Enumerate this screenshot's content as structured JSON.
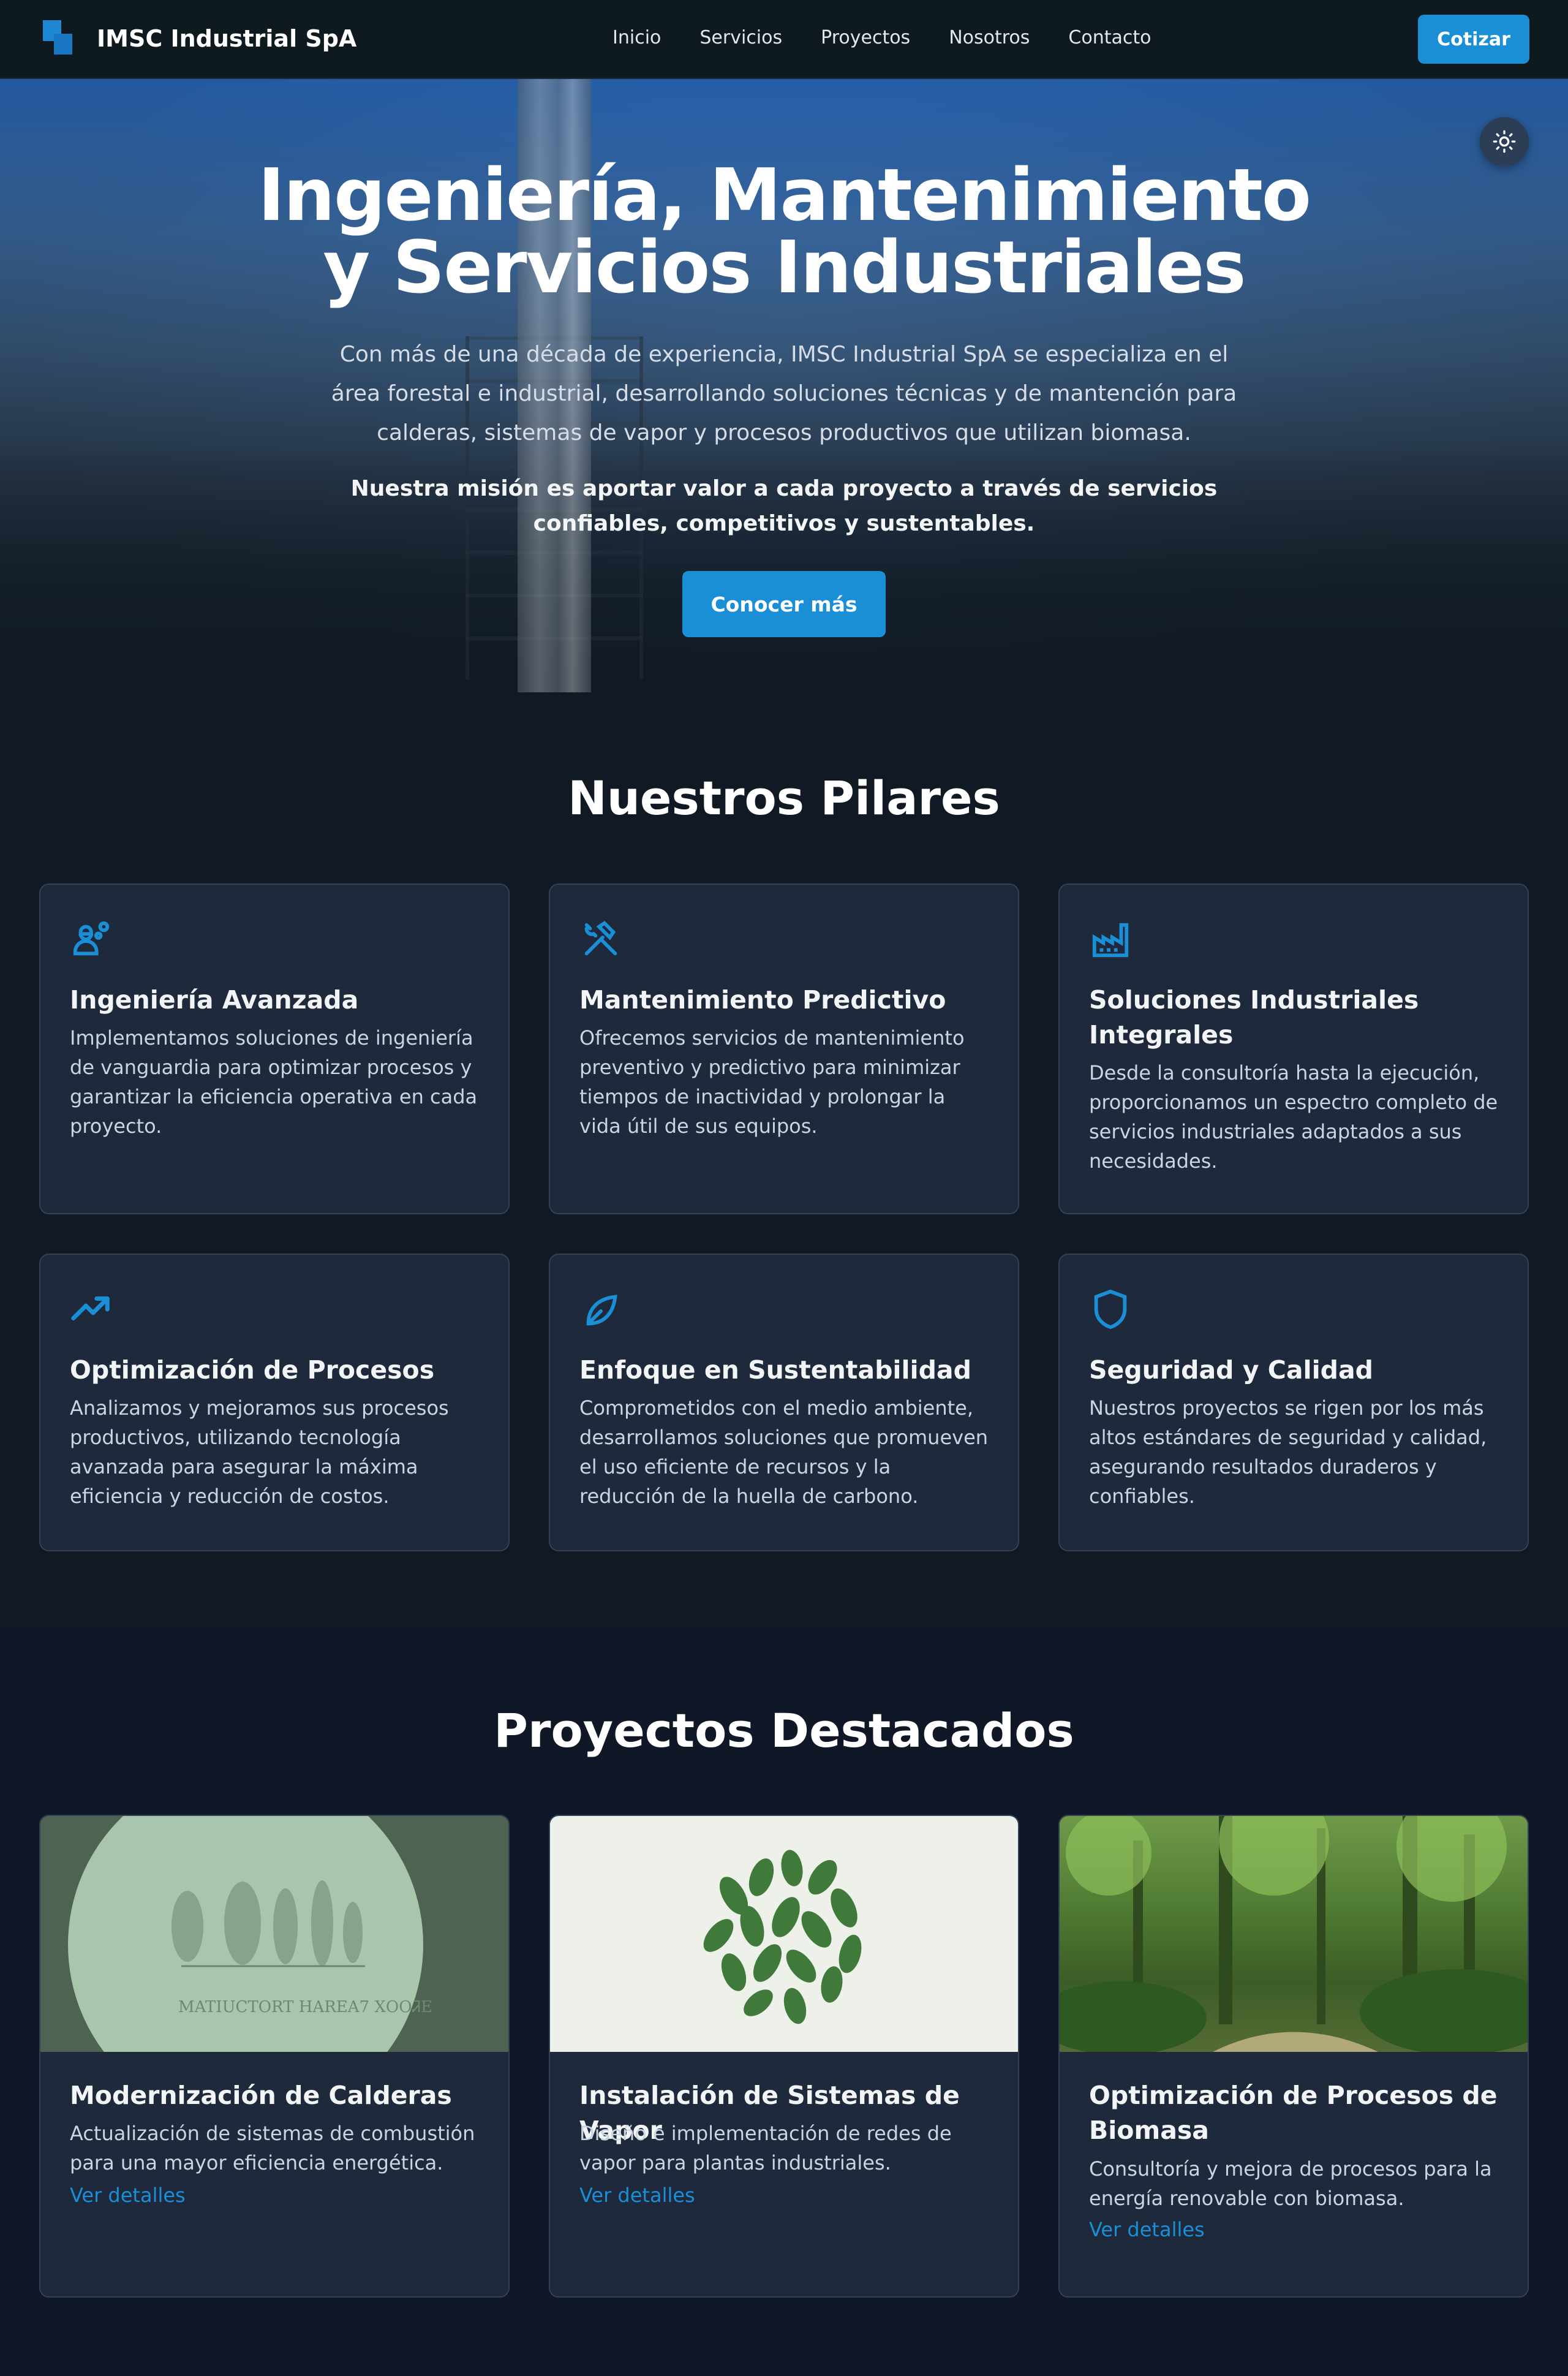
{
  "navbar": {
    "brand": "IMSC Industrial SpA",
    "links": [
      "Inicio",
      "Servicios",
      "Proyectos",
      "Nosotros",
      "Contacto"
    ],
    "cta": "Cotizar"
  },
  "hero": {
    "title_line1": "Ingeniería, Mantenimiento",
    "title_line2": "y Servicios Industriales",
    "text": "Con más de una década de experiencia, IMSC Industrial SpA se especializa en el área forestal e industrial, desarrollando soluciones técnicas y de mantención para calderas, sistemas de vapor y procesos productivos que utilizan biomasa.",
    "mission": "Nuestra misión es aportar valor a cada proyecto a través de servicios confiables, competitivos y sustentables.",
    "button": "Conocer más",
    "theme_icon": "sun-icon"
  },
  "pilares": {
    "title": "Nuestros Pilares",
    "cards": [
      {
        "icon": "engineer-icon",
        "title": "Ingeniería Avanzada",
        "desc": "Implementamos soluciones de ingeniería de vanguardia para optimizar procesos y garantizar la eficiencia operativa en cada proyecto."
      },
      {
        "icon": "tools-icon",
        "title": "Mantenimiento Predictivo",
        "desc": "Ofrecemos servicios de mantenimiento preventivo y predictivo para minimizar tiempos de inactividad y prolongar la vida útil de sus equipos."
      },
      {
        "icon": "factory-icon",
        "title": "Soluciones Industriales Integrales",
        "desc": "Desde la consultoría hasta la ejecución, proporcionamos un espectro completo de servicios industriales adaptados a sus necesidades."
      },
      {
        "icon": "trending-up-icon",
        "title": "Optimización de Procesos",
        "desc": "Analizamos y mejoramos sus procesos productivos, utilizando tecnología avanzada para asegurar la máxima eficiencia y reducción de costos."
      },
      {
        "icon": "leaf-icon",
        "title": "Enfoque en Sustentabilidad",
        "desc": "Comprometidos con el medio ambiente, desarrollamos soluciones que promueven el uso eficiente de recursos y la reducción de la huella de carbono."
      },
      {
        "icon": "shield-icon",
        "title": "Seguridad y Calidad",
        "desc": "Nuestros proyectos se rigen por los más altos estándares de seguridad y calidad, asegurando resultados duraderos y confiables."
      }
    ]
  },
  "proyectos": {
    "title": "Proyectos Destacados",
    "cards": [
      {
        "title": "Modernización de Calderas",
        "desc": "Actualización de sistemas de combustión para una mayor eficiencia energética.",
        "link": "Ver detalles",
        "image_text": "MATIUCTORT HAREA7 ⅩOOᏘE"
      },
      {
        "title": "Instalación de Sistemas de Vapor",
        "desc": "Diseño e implementación de redes de vapor para plantas industriales.",
        "link": "Ver detalles"
      },
      {
        "title": "Optimización de Procesos de Biomasa",
        "desc": "Consultoría y mejora de procesos para la energía renovable con biomasa.",
        "link": "Ver detalles"
      }
    ]
  },
  "colors": {
    "accent": "#1a8fd6",
    "background": "#111827",
    "card": "#1e293b"
  }
}
